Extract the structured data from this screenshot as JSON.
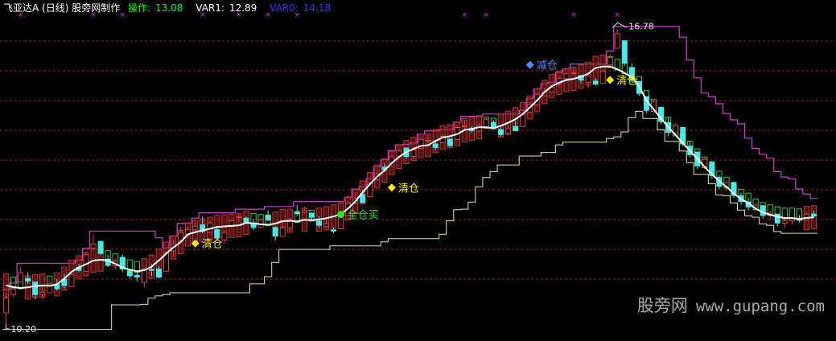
{
  "header": {
    "title": "飞亚达A (日线) 股旁网制作",
    "op_label": "操作:",
    "op_value": "13.08",
    "var1_label": "VAR1:",
    "var1_value": "12.89",
    "var0_label": "VAR0:",
    "var0_value": "14.18"
  },
  "annotations": {
    "high_price": "16.78",
    "low_price": "10.20",
    "signals": [
      "清仓",
      "全仓买",
      "清仓",
      "减仓",
      "清仓"
    ]
  },
  "watermark": {
    "cn": "股旁网",
    "en": "www.gupang.com"
  },
  "colors": {
    "background": "#000000",
    "title": "#ffffff",
    "op": "#00ff00",
    "var1": "#ffffff",
    "var0": "#3333ff",
    "candle_up": "#e23a3a",
    "candle_down": "#46e8e8",
    "band_up": "#b83232",
    "band_down": "#33cc33",
    "upper_band": "#d040d0",
    "lower_band": "#e6e6a0",
    "midline": "#ffffff",
    "grid": "#9b2525",
    "marker_x": "#cc33cc",
    "sell_marker": "#ffee00",
    "buy_marker": "#22ee22",
    "reduce_marker": "#5588ff"
  },
  "chart_data": {
    "type": "candlestick",
    "title": "飞亚达A (日线)",
    "ylim": [
      10.0,
      17.2
    ],
    "grid": true,
    "indicators": {
      "操作": 13.08,
      "VAR1": 12.89,
      "VAR0": 14.18
    },
    "extremes": {
      "high": 16.78,
      "low": 10.2
    },
    "candles": [
      [
        10.45,
        10.89,
        10.2,
        10.78
      ],
      [
        10.86,
        11.04,
        10.8,
        10.98
      ],
      [
        11.14,
        11.48,
        11.14,
        11.35
      ],
      [
        11.22,
        11.36,
        11.09,
        11.16
      ],
      [
        11.14,
        11.14,
        10.75,
        10.86
      ],
      [
        10.86,
        11.03,
        10.76,
        10.91
      ],
      [
        10.9,
        11.17,
        10.9,
        11.1
      ],
      [
        11.08,
        11.21,
        10.95,
        10.99
      ],
      [
        11.2,
        11.32,
        10.98,
        11.06
      ],
      [
        11.04,
        11.35,
        11.04,
        11.3
      ],
      [
        11.47,
        11.55,
        11.36,
        11.4
      ],
      [
        11.38,
        11.81,
        11.38,
        11.75
      ],
      [
        11.9,
        12.2,
        11.87,
        11.99
      ],
      [
        12.05,
        12.05,
        11.74,
        11.78
      ],
      [
        11.65,
        11.75,
        11.48,
        11.51
      ],
      [
        11.5,
        11.66,
        11.42,
        11.61
      ],
      [
        11.69,
        11.76,
        11.36,
        11.43
      ],
      [
        11.38,
        11.4,
        11.21,
        11.28
      ],
      [
        11.29,
        11.36,
        11.15,
        11.25
      ],
      [
        11.13,
        11.45,
        11.02,
        11.42
      ],
      [
        11.42,
        11.54,
        11.27,
        11.41
      ],
      [
        11.43,
        11.5,
        11.22,
        11.25
      ],
      [
        11.38,
        11.82,
        11.38,
        11.8
      ],
      [
        11.84,
        12.09,
        11.7,
        11.98
      ],
      [
        12.07,
        12.37,
        12.07,
        12.25
      ],
      [
        12.2,
        12.38,
        12.11,
        12.31
      ],
      [
        12.31,
        12.49,
        12.27,
        12.39
      ],
      [
        12.42,
        12.61,
        12.23,
        12.27
      ],
      [
        12.26,
        12.51,
        12.24,
        12.46
      ],
      [
        12.31,
        12.38,
        12.05,
        12.13
      ],
      [
        12.08,
        12.3,
        11.99,
        12.25
      ],
      [
        12.39,
        12.54,
        12.33,
        12.51
      ],
      [
        12.6,
        12.69,
        12.48,
        12.6
      ],
      [
        12.57,
        12.6,
        12.44,
        12.48
      ],
      [
        12.46,
        12.55,
        12.3,
        12.36
      ],
      [
        12.36,
        12.58,
        12.34,
        12.53
      ],
      [
        12.63,
        12.75,
        12.5,
        12.53
      ],
      [
        12.36,
        12.39,
        12.07,
        12.17
      ],
      [
        12.16,
        12.48,
        12.16,
        12.35
      ],
      [
        12.35,
        12.58,
        12.27,
        12.53
      ],
      [
        12.71,
        12.86,
        12.62,
        12.67
      ],
      [
        12.7,
        12.83,
        12.67,
        12.74
      ],
      [
        12.68,
        12.7,
        12.54,
        12.59
      ],
      [
        12.5,
        12.61,
        12.35,
        12.41
      ],
      [
        12.38,
        12.57,
        12.34,
        12.44
      ],
      [
        12.31,
        12.36,
        12.23,
        12.28
      ],
      [
        12.33,
        12.65,
        12.33,
        12.63
      ],
      [
        12.63,
        12.95,
        12.63,
        12.89
      ],
      [
        12.9,
        13.14,
        12.88,
        13.0
      ],
      [
        13.1,
        13.2,
        12.89,
        12.92
      ],
      [
        13.05,
        13.38,
        13.05,
        13.35
      ],
      [
        13.43,
        13.64,
        13.39,
        13.56
      ],
      [
        13.71,
        13.8,
        13.6,
        13.66
      ],
      [
        13.73,
        14.0,
        13.73,
        13.94
      ],
      [
        13.94,
        14.13,
        13.9,
        14.07
      ],
      [
        14.14,
        14.14,
        13.89,
        13.95
      ],
      [
        13.95,
        14.17,
        13.88,
        14.09
      ],
      [
        14.13,
        14.37,
        14.13,
        14.33
      ],
      [
        14.31,
        14.44,
        14.25,
        14.31
      ],
      [
        14.23,
        14.32,
        14.08,
        14.15
      ],
      [
        14.26,
        14.47,
        14.25,
        14.4
      ],
      [
        14.34,
        14.36,
        14.16,
        14.19
      ],
      [
        14.33,
        14.64,
        14.33,
        14.6
      ],
      [
        14.63,
        14.77,
        14.54,
        14.64
      ],
      [
        14.56,
        14.63,
        14.49,
        14.53
      ],
      [
        14.52,
        14.69,
        14.48,
        14.65
      ],
      [
        14.61,
        14.82,
        14.6,
        14.78
      ],
      [
        14.71,
        14.76,
        14.57,
        14.6
      ],
      [
        14.55,
        14.6,
        14.39,
        14.44
      ],
      [
        14.47,
        14.66,
        14.47,
        14.57
      ],
      [
        14.62,
        14.74,
        14.51,
        14.53
      ],
      [
        14.62,
        14.9,
        14.62,
        14.89
      ],
      [
        14.94,
        15.17,
        14.94,
        15.12
      ],
      [
        15.11,
        15.38,
        15.08,
        15.34
      ],
      [
        15.31,
        15.5,
        15.28,
        15.39
      ],
      [
        15.4,
        15.53,
        15.39,
        15.5
      ],
      [
        15.57,
        15.75,
        15.5,
        15.7
      ],
      [
        15.69,
        15.83,
        15.65,
        15.8
      ],
      [
        15.81,
        15.94,
        15.75,
        15.82
      ],
      [
        15.76,
        15.76,
        15.58,
        15.66
      ],
      [
        15.61,
        15.8,
        15.48,
        15.76
      ],
      [
        15.64,
        15.7,
        15.53,
        15.57
      ],
      [
        15.59,
        15.9,
        15.59,
        15.85
      ],
      [
        16.0,
        16.23,
        15.97,
        16.16
      ],
      [
        16.37,
        16.78,
        16.37,
        16.7
      ],
      [
        16.54,
        16.54,
        15.98,
        16.04
      ],
      [
        15.94,
        16.03,
        15.6,
        15.65
      ],
      [
        15.63,
        15.63,
        15.31,
        15.36
      ],
      [
        15.29,
        15.29,
        14.92,
        14.98
      ],
      [
        14.96,
        15.21,
        14.94,
        15.17
      ],
      [
        15.05,
        15.05,
        14.67,
        14.73
      ],
      [
        14.71,
        14.83,
        14.41,
        14.49
      ],
      [
        14.48,
        14.69,
        14.43,
        14.65
      ],
      [
        14.6,
        14.6,
        14.19,
        14.24
      ],
      [
        14.18,
        14.28,
        13.93,
        13.99
      ],
      [
        14.05,
        14.05,
        13.67,
        13.74
      ],
      [
        13.73,
        13.92,
        13.68,
        13.88
      ],
      [
        13.83,
        13.83,
        13.46,
        13.52
      ],
      [
        13.48,
        13.53,
        13.21,
        13.28
      ],
      [
        13.28,
        13.41,
        13.19,
        13.36
      ],
      [
        13.37,
        13.37,
        13.03,
        13.08
      ],
      [
        13.07,
        13.14,
        12.87,
        12.94
      ],
      [
        12.93,
        13.03,
        12.74,
        12.82
      ],
      [
        12.81,
        12.93,
        12.71,
        12.86
      ],
      [
        12.85,
        12.85,
        12.56,
        12.63
      ],
      [
        12.63,
        12.73,
        12.53,
        12.68
      ],
      [
        12.66,
        12.66,
        12.39,
        12.46
      ],
      [
        12.46,
        12.55,
        12.35,
        12.51
      ],
      [
        12.51,
        12.6,
        12.42,
        12.56
      ],
      [
        12.56,
        12.64,
        12.47,
        12.52
      ],
      [
        12.53,
        12.7,
        12.49,
        12.66
      ],
      [
        12.66,
        12.74,
        12.58,
        12.62
      ]
    ]
  }
}
